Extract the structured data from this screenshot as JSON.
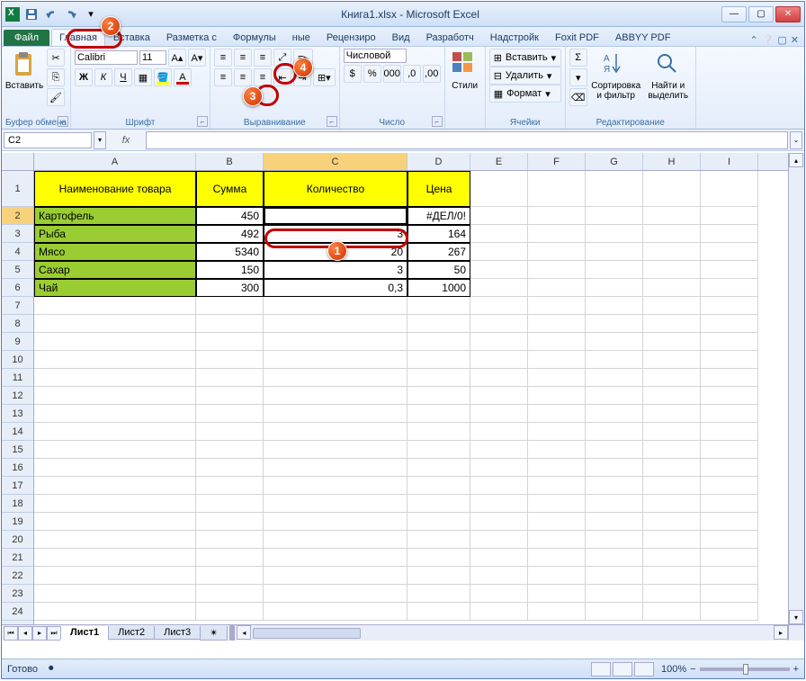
{
  "title": "Книга1.xlsx - Microsoft Excel",
  "tabs": {
    "file": "Файл",
    "home": "Главная",
    "insert": "Вставка",
    "layout": "Разметка с",
    "formulas": "Формулы",
    "data": "ные",
    "review": "Рецензиро",
    "view": "Вид",
    "developer": "Разработч",
    "addins": "Надстройк",
    "foxit": "Foxit PDF",
    "abbyy": "ABBYY PDF"
  },
  "groups": {
    "clipboard": "Буфер обмена",
    "font": "Шрифт",
    "alignment": "Выравнивание",
    "number": "Число",
    "styles": "Стили",
    "cells": "Ячейки",
    "editing": "Редактирование"
  },
  "buttons": {
    "paste": "Вставить",
    "styles": "Стили",
    "insert": "Вставить",
    "delete": "Удалить",
    "format": "Формат",
    "sort": "Сортировка и фильтр",
    "find": "Найти и выделить"
  },
  "font": {
    "name": "Calibri",
    "size": "11"
  },
  "number_format": "Числовой",
  "namebox": "C2",
  "formula": "",
  "columns": [
    "A",
    "B",
    "C",
    "D",
    "E",
    "F",
    "G",
    "H",
    "I"
  ],
  "headers": [
    "Наименование товара",
    "Сумма",
    "Количество",
    "Цена"
  ],
  "rows": [
    {
      "name": "Картофель",
      "sum": "450",
      "qty": "",
      "price": "#ДЕЛ/0!"
    },
    {
      "name": "Рыба",
      "sum": "492",
      "qty": "3",
      "price": "164"
    },
    {
      "name": "Мясо",
      "sum": "5340",
      "qty": "20",
      "price": "267"
    },
    {
      "name": "Сахар",
      "sum": "150",
      "qty": "3",
      "price": "50"
    },
    {
      "name": "Чай",
      "sum": "300",
      "qty": "0,3",
      "price": "1000"
    }
  ],
  "sheets": [
    "Лист1",
    "Лист2",
    "Лист3"
  ],
  "status": "Готово",
  "zoom": "100%",
  "callouts": {
    "c1": "1",
    "c2": "2",
    "c3": "3",
    "c4": "4"
  }
}
